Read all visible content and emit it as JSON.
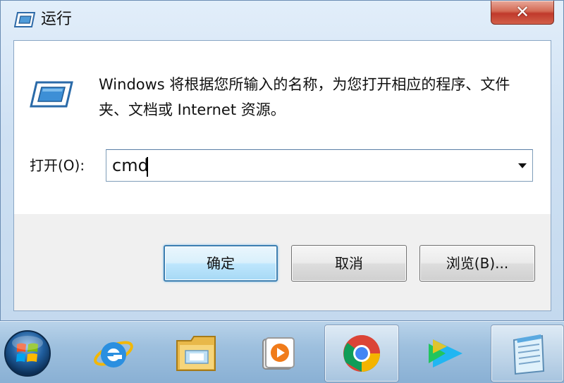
{
  "window": {
    "title": "运行",
    "close_symbol": "✕"
  },
  "dialog": {
    "description": "Windows 将根据您所输入的名称，为您打开相应的程序、文件夹、文档或 Internet 资源。",
    "open_label": "打开(O):",
    "command_value": "cmd"
  },
  "buttons": {
    "ok": "确定",
    "cancel": "取消",
    "browse": "浏览(B)..."
  },
  "taskbar": {
    "items": [
      {
        "icon": "start-orb-icon"
      },
      {
        "icon": "internet-explorer-icon"
      },
      {
        "icon": "file-explorer-icon"
      },
      {
        "icon": "media-player-icon"
      },
      {
        "icon": "chrome-icon"
      },
      {
        "icon": "video-player-icon"
      },
      {
        "icon": "notepad-icon"
      }
    ]
  },
  "colors": {
    "window_glass": "#cfe1f3",
    "close_red": "#c0392b",
    "focus_blue": "#3c7fb1"
  }
}
